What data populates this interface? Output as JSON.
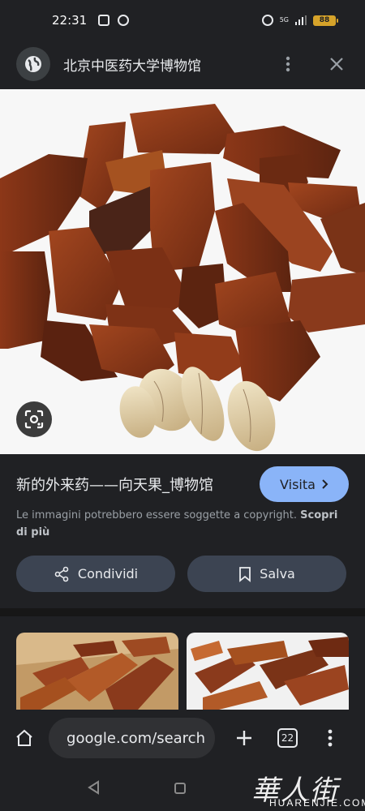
{
  "status_bar": {
    "time": "22:31",
    "network": "5G",
    "battery": "88"
  },
  "header": {
    "site_name": "北京中医药大学博物馆"
  },
  "result": {
    "title": "新的外来药——向天果_博物馆",
    "visit_label": "Visita",
    "copyright_text": "Le immagini potrebbero essere soggette a copyright.",
    "learn_more": "Scopri di più",
    "share_label": "Condividi",
    "save_label": "Salva"
  },
  "toolbar": {
    "url": "google.com/search",
    "tab_count": "22"
  },
  "watermark": {
    "glyphs": "華人街",
    "latin": "HUARENJIE.COM"
  },
  "colors": {
    "background": "#202124",
    "visit_button": "#8ab4f8",
    "pill_button": "#3c4452",
    "seed_brown": "#8a3a1c"
  },
  "icons": [
    "globe-icon",
    "more-vert-icon",
    "close-icon",
    "google-lens-icon",
    "share-icon",
    "bookmark-icon",
    "chevron-right-icon",
    "home-icon",
    "tune-icon",
    "plus-icon",
    "tabs-icon",
    "back-triangle-icon"
  ]
}
